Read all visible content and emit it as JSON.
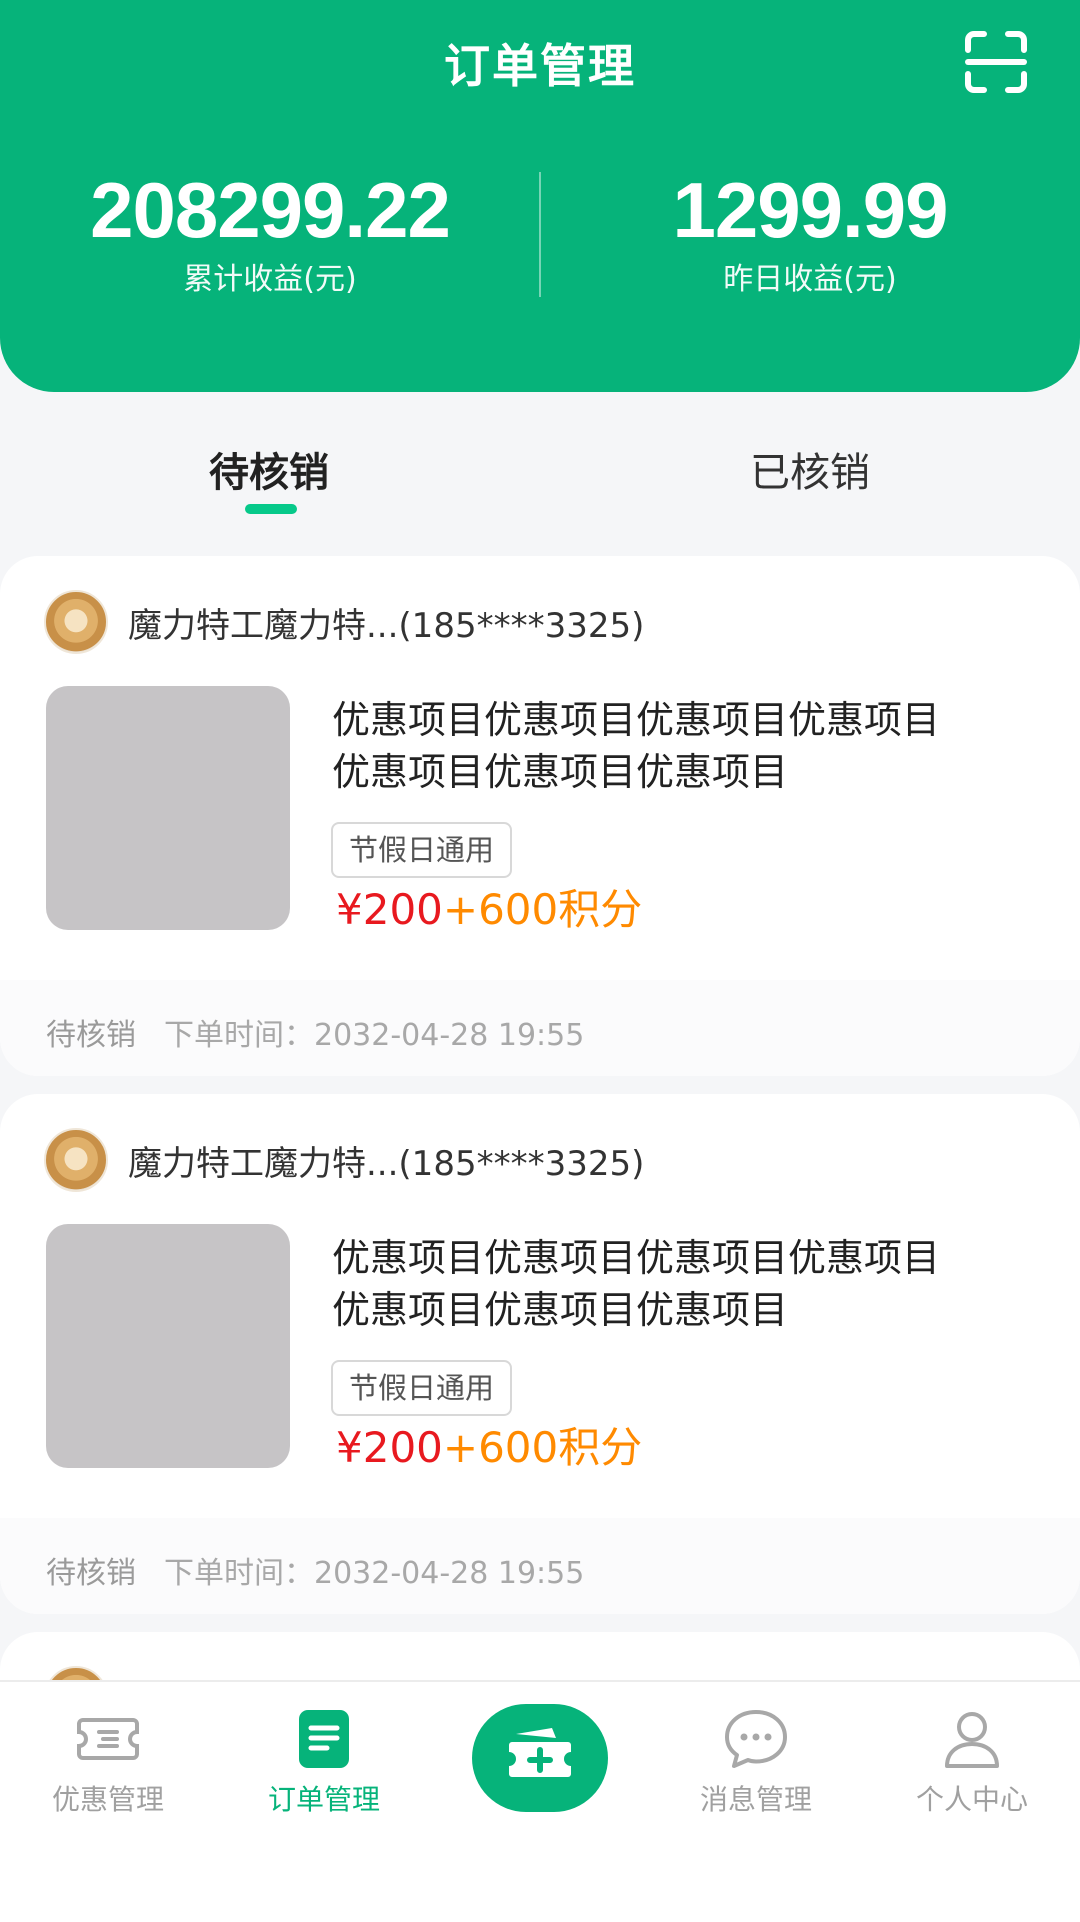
{
  "header": {
    "title": "订单管理",
    "scan_icon": "scan-icon",
    "total_earnings": "208299.22",
    "total_earnings_label": "累计收益(元)",
    "yesterday_earnings": "1299.99",
    "yesterday_earnings_label": "昨日收益(元)"
  },
  "tabs": [
    {
      "label": "待核销",
      "active": true
    },
    {
      "label": "已核销",
      "active": false
    }
  ],
  "orders": [
    {
      "user": "魔力特工魔力特...(185****3325)",
      "title": "优惠项目优惠项目优惠项目优惠项目优惠项目优惠项目优惠项目",
      "tag": "节假日通用",
      "price": "¥200",
      "points": "+600积分",
      "status": "待核销",
      "order_time": "下单时间：2032-04-28 19:55"
    },
    {
      "user": "魔力特工魔力特...(185****3325)",
      "title": "优惠项目优惠项目优惠项目优惠项目优惠项目优惠项目优惠项目",
      "tag": "节假日通用",
      "price": "¥200",
      "points": "+600积分",
      "status": "待核销",
      "order_time": "下单时间：2032-04-28 19:55"
    }
  ],
  "tabbar": [
    {
      "label": "优惠管理",
      "icon": "ticket-icon",
      "active": false
    },
    {
      "label": "订单管理",
      "icon": "order-doc-icon",
      "active": true
    },
    {
      "label": "",
      "icon": "add-ticket-icon",
      "active": false
    },
    {
      "label": "消息管理",
      "icon": "chat-bubble-icon",
      "active": false
    },
    {
      "label": "个人中心",
      "icon": "user-icon",
      "active": false
    }
  ],
  "colors": {
    "brand": "#06b37a",
    "price": "#e8191f",
    "points": "#ff8a00"
  }
}
